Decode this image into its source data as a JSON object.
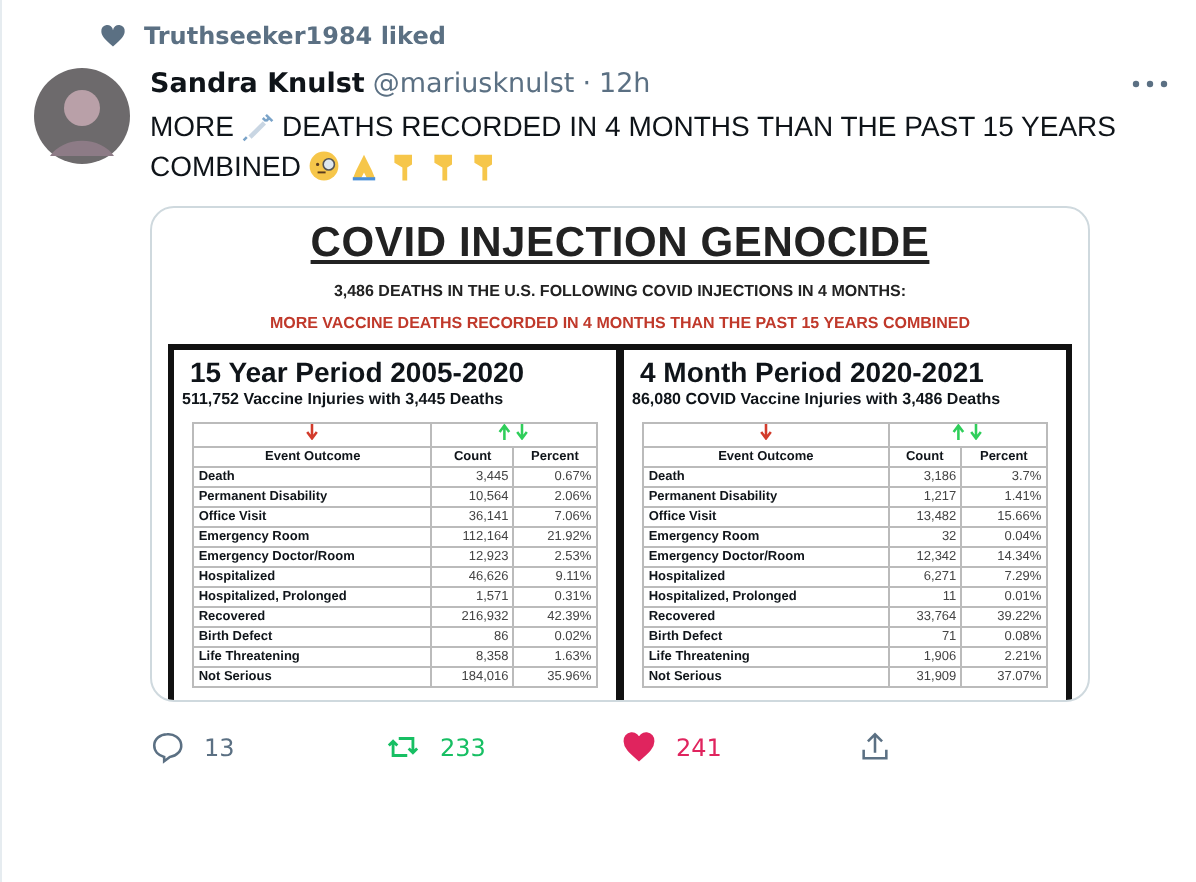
{
  "social_context": {
    "text": "Truthseeker1984 liked"
  },
  "tweet": {
    "author": "Sandra Knulst",
    "handle": "@mariusknulst",
    "separator": "·",
    "time": "12h",
    "text_start": "MORE",
    "text_line1": "DEATHS RECORDED IN 4 MONTHS THAN THE PAST 15 YEARS",
    "text_line2": "COMBINED"
  },
  "image": {
    "title": "COVID INJECTION GENOCIDE",
    "subtitle": "3,486 DEATHS IN THE U.S. FOLLOWING COVID INJECTIONS IN 4 MONTHS:",
    "highlight": "MORE VACCINE DEATHS RECORDED IN 4 MONTHS THAN THE PAST 15 YEARS COMBINED",
    "panels": [
      {
        "heading": "15 Year Period 2005-2020",
        "subheading": "511,752 Vaccine Injuries with 3,445 Deaths",
        "columns": [
          "Event Outcome",
          "Count",
          "Percent"
        ],
        "rows": [
          [
            "Death",
            "3,445",
            "0.67%"
          ],
          [
            "Permanent Disability",
            "10,564",
            "2.06%"
          ],
          [
            "Office Visit",
            "36,141",
            "7.06%"
          ],
          [
            "Emergency Room",
            "112,164",
            "21.92%"
          ],
          [
            "Emergency Doctor/Room",
            "12,923",
            "2.53%"
          ],
          [
            "Hospitalized",
            "46,626",
            "9.11%"
          ],
          [
            "Hospitalized, Prolonged",
            "1,571",
            "0.31%"
          ],
          [
            "Recovered",
            "216,932",
            "42.39%"
          ],
          [
            "Birth Defect",
            "86",
            "0.02%"
          ],
          [
            "Life Threatening",
            "8,358",
            "1.63%"
          ],
          [
            "Not Serious",
            "184,016",
            "35.96%"
          ]
        ]
      },
      {
        "heading": "4 Month Period 2020-2021",
        "subheading": "86,080 COVID Vaccine Injuries with 3,486 Deaths",
        "columns": [
          "Event Outcome",
          "Count",
          "Percent"
        ],
        "rows": [
          [
            "Death",
            "3,186",
            "3.7%"
          ],
          [
            "Permanent Disability",
            "1,217",
            "1.41%"
          ],
          [
            "Office Visit",
            "13,482",
            "15.66%"
          ],
          [
            "Emergency Room",
            "32",
            "0.04%"
          ],
          [
            "Emergency Doctor/Room",
            "12,342",
            "14.34%"
          ],
          [
            "Hospitalized",
            "6,271",
            "7.29%"
          ],
          [
            "Hospitalized, Prolonged",
            "11",
            "0.01%"
          ],
          [
            "Recovered",
            "33,764",
            "39.22%"
          ],
          [
            "Birth Defect",
            "71",
            "0.08%"
          ],
          [
            "Life Threatening",
            "1,906",
            "2.21%"
          ],
          [
            "Not Serious",
            "31,909",
            "37.07%"
          ]
        ]
      }
    ]
  },
  "actions": {
    "replies": "13",
    "retweets": "233",
    "retweeted": true,
    "likes": "241",
    "liked": true
  }
}
